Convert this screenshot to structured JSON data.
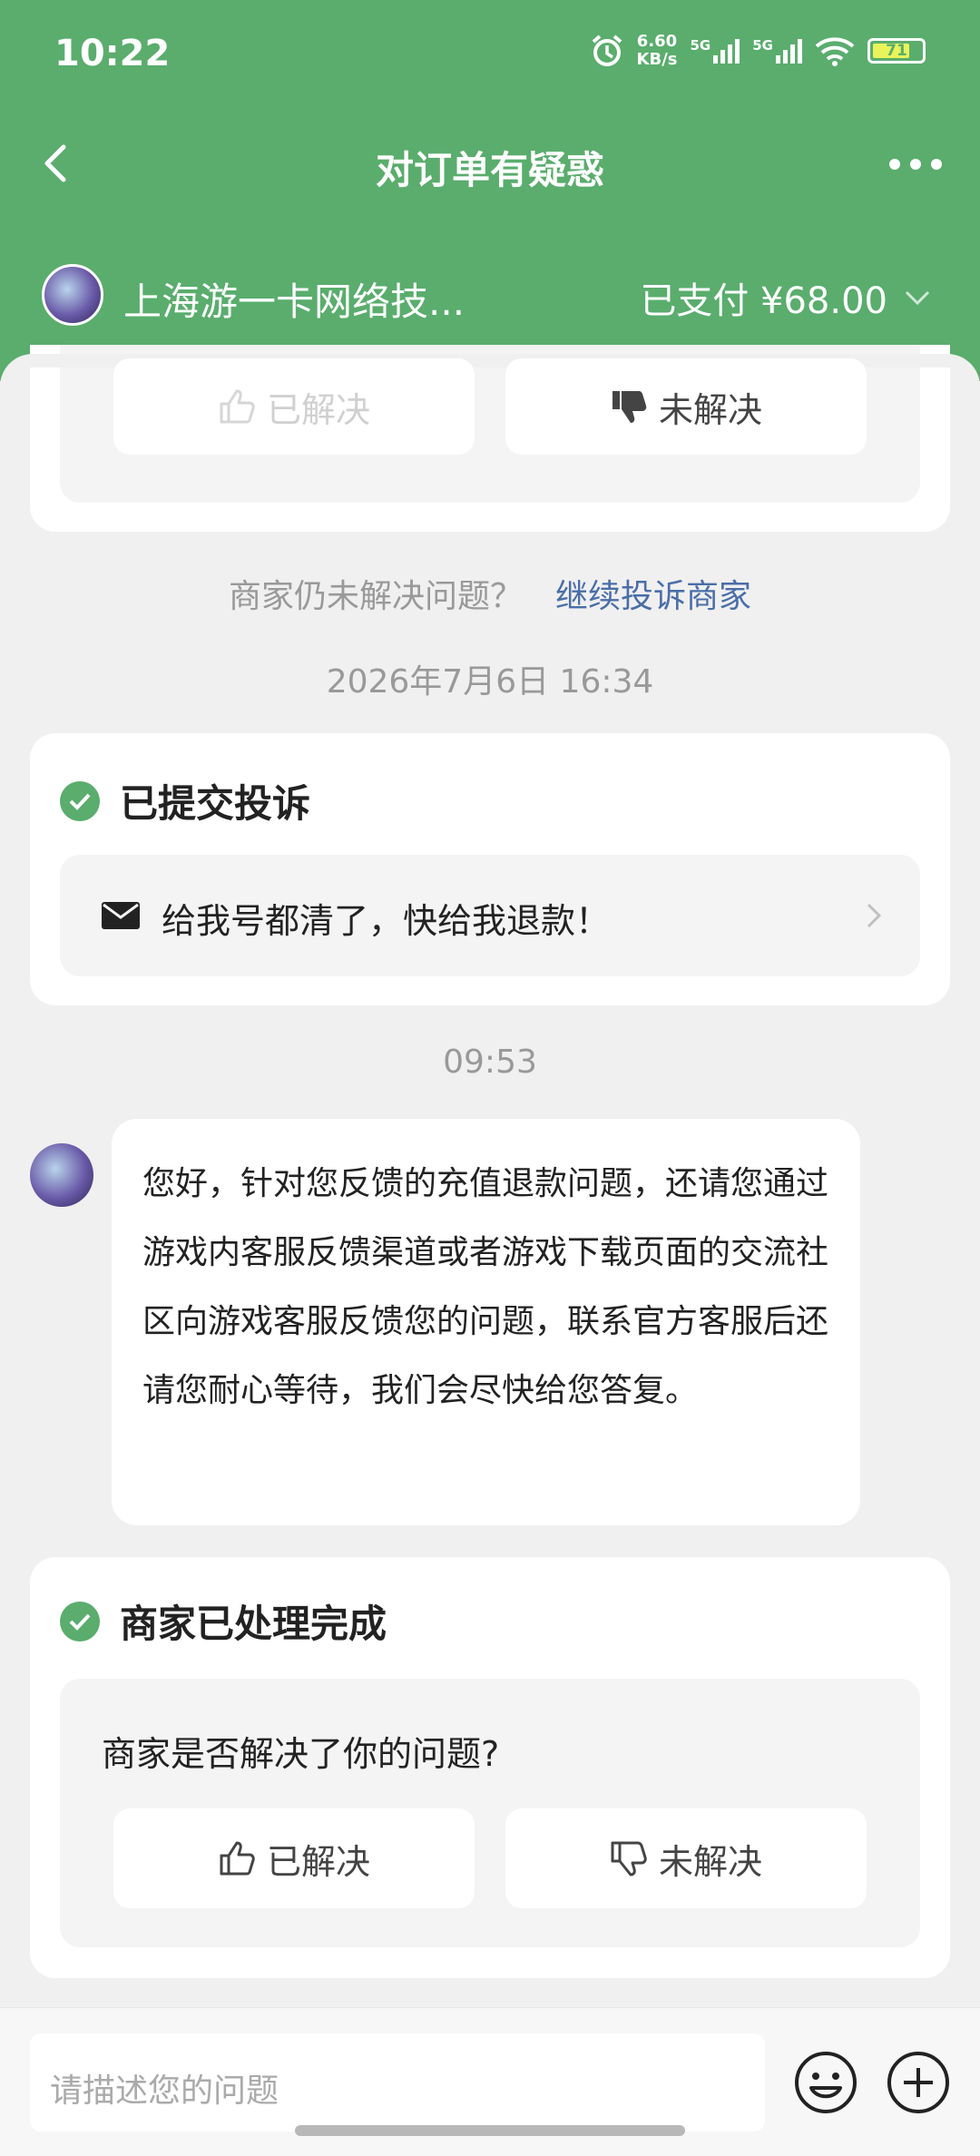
{
  "status_bar": {
    "time": "10:22",
    "net_speed_value": "6.60",
    "net_speed_unit": "KB/s",
    "sim1": "5G",
    "sim2": "5G",
    "battery": "71"
  },
  "nav": {
    "title": "对订单有疑惑"
  },
  "merchant": {
    "name": "上海游一卡网络技...",
    "paid_text": "已支付 ¥68.00"
  },
  "top_card": {
    "solved_label": "已解决",
    "unsolved_label": "未解决"
  },
  "complaint_prompt": {
    "text": "商家仍未解决问题？",
    "link": "继续投诉商家"
  },
  "timestamp1": "2026年7月6日 16:34",
  "complaint_card": {
    "title": "已提交投诉",
    "message": "给我号都清了，快给我退款！"
  },
  "timestamp2": "09:53",
  "chat": {
    "message": "您好，针对您反馈的充值退款问题，还请您通过游戏内客服反馈渠道或者游戏下载页面的交流社区向游戏客服反馈您的问题，联系官方客服后还请您耐心等待，我们会尽快给您答复。"
  },
  "resolved_card": {
    "title": "商家已处理完成",
    "question": "商家是否解决了你的问题?",
    "solved_label": "已解决",
    "unsolved_label": "未解决"
  },
  "input": {
    "placeholder": "请描述您的问题"
  },
  "colors": {
    "brand_green": "#5aad6d",
    "link_blue": "#4a6ea8"
  }
}
